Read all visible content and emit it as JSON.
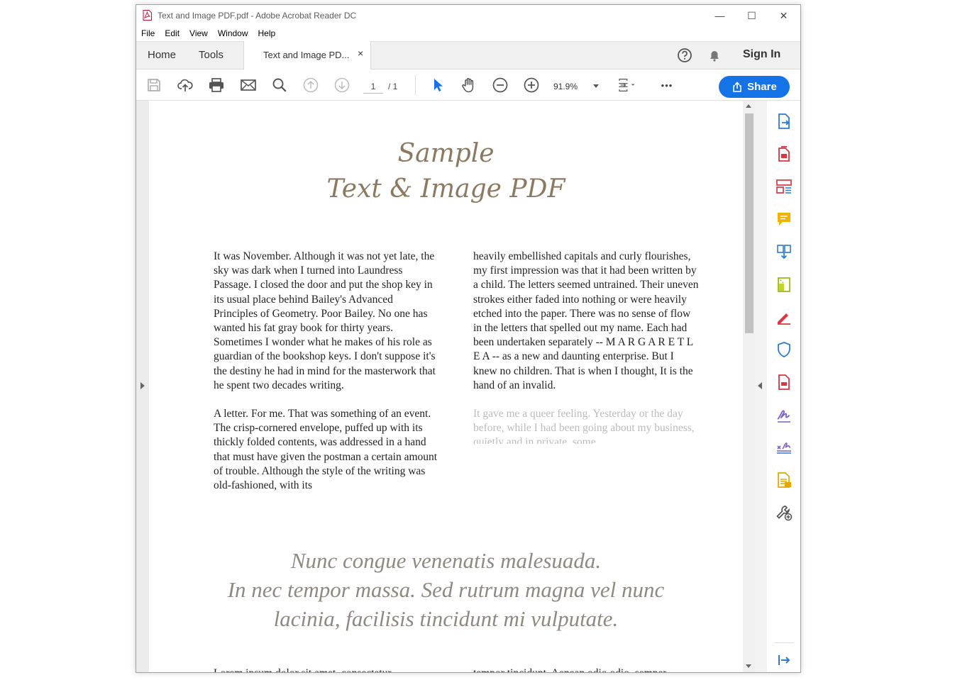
{
  "window": {
    "title": "Text and Image PDF.pdf - Adobe Acrobat Reader DC",
    "minimize": "—",
    "maximize": "☐",
    "close": "✕"
  },
  "menu": [
    "File",
    "Edit",
    "View",
    "Window",
    "Help"
  ],
  "tabs": {
    "home": "Home",
    "tools": "Tools",
    "document": "Text and Image PD...",
    "close": "×"
  },
  "header": {
    "sign_in": "Sign In"
  },
  "toolbar": {
    "page_current": "1",
    "page_total": "/ 1",
    "zoom": "91.9%",
    "share": "Share",
    "more": "•••"
  },
  "document": {
    "title_line1": "Sample",
    "title_line2": "Text & Image PDF",
    "col1_p1": "It was November. Although it was not yet late, the sky was dark when I turned into Laundress Passage. I closed the door and put the shop key in its usual place behind Bailey's Advanced Principles of Geometry. Poor Bailey. No one has wanted his fat gray book for thirty years. Sometimes I wonder what he makes of his role as guardian of the bookshop keys. I don't suppose it's the destiny he had in mind for the masterwork that he spent two decades writing.",
    "col1_p2": "A letter. For me. That was something of an event. The crisp-cornered envelope, puffed up with its thickly folded contents, was addressed in a hand that must have given the postman a certain amount of trouble. Although the style of the writing was old-fashioned, with its",
    "col2_p1": "heavily embellished capitals and curly flourishes, my first impression was that it had been written by a child. The letters seemed untrained. Their uneven strokes either faded into nothing or were heavily etched into the paper. There was no sense of flow in the letters that spelled out my name. Each had been undertaken separately -- M A R G A R E T L E A -- as a new and daunting enterprise. But I knew no children. That is when I thought, It is the hand of an invalid.",
    "col2_p2": "It gave me a queer feeling. Yesterday or the day before, while I had been going about my business, quietly and in private, some",
    "quote_line1": "Nunc congue venenatis malesuada.",
    "quote_line2": "In nec tempor massa. Sed rutrum magna vel nunc",
    "quote_line3": "lacinia, facilisis tincidunt mi vulputate.",
    "bottom_left": "Lorem ipsum dolor sit amet, consectetur",
    "bottom_right": "tempor tincidunt. Aenean odio odio, semper"
  },
  "colors": {
    "accent": "#1473e6",
    "title_text": "#8c7a60",
    "quote_text": "#8f8a80"
  },
  "right_panel_icons": [
    "export-pdf-icon",
    "create-pdf-icon",
    "organize-pages-icon",
    "comment-icon",
    "combine-files-icon",
    "compress-pdf-icon",
    "edit-pdf-icon",
    "protect-icon",
    "export-pdf-red-icon",
    "fill-sign-icon",
    "send-for-signature-icon",
    "send-track-icon",
    "more-tools-icon",
    "expand-panel-icon"
  ]
}
